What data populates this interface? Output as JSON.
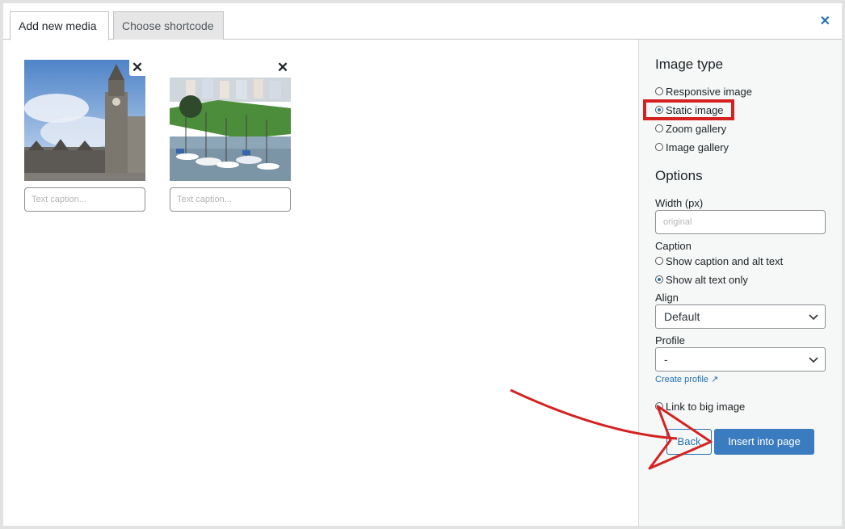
{
  "tabs": [
    {
      "label": "Add new media",
      "active": true
    },
    {
      "label": "Choose shortcode",
      "active": false
    }
  ],
  "close_icon": "close-icon",
  "media": [
    {
      "caption_placeholder": "Text caption..."
    },
    {
      "caption_placeholder": "Text caption..."
    }
  ],
  "sidebar": {
    "image_type_heading": "Image type",
    "image_types": [
      {
        "label": "Responsive image",
        "checked": false
      },
      {
        "label": "Static image",
        "checked": true
      },
      {
        "label": "Zoom gallery",
        "checked": false
      },
      {
        "label": "Image gallery",
        "checked": false
      }
    ],
    "options_heading": "Options",
    "width_label": "Width (px)",
    "width_placeholder": "original",
    "caption_label": "Caption",
    "caption_options": [
      {
        "label": "Show caption and alt text",
        "checked": false
      },
      {
        "label": "Show alt text only",
        "checked": true
      }
    ],
    "align_label": "Align",
    "align_value": "Default",
    "profile_label": "Profile",
    "profile_value": "-",
    "create_profile_link": "Create profile ↗",
    "link_big_image_label": "Link to big image",
    "back_button": "Back",
    "insert_button": "Insert into page"
  },
  "colors": {
    "accent": "#2271b1",
    "primary_button": "#3a7cbf",
    "annotation": "#d42222"
  }
}
